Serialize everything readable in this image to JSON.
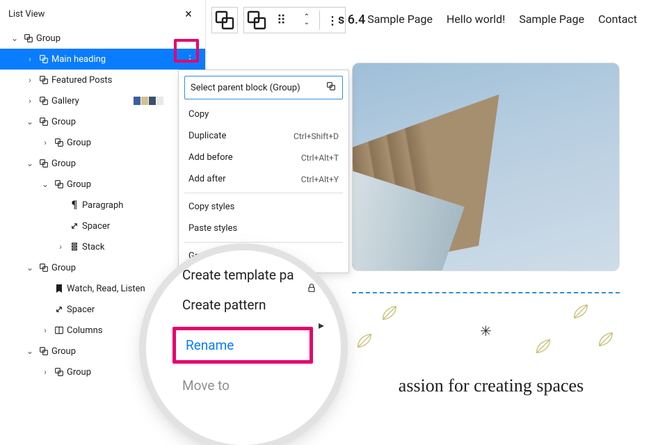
{
  "listView": {
    "title": "List View",
    "items": [
      {
        "toggle": "v",
        "icon": "group",
        "label": "Group",
        "indent": 0
      },
      {
        "toggle": ">",
        "icon": "group",
        "label": "Main heading",
        "indent": 1,
        "selected": true,
        "showActions": true
      },
      {
        "toggle": ">",
        "icon": "group",
        "label": "Featured Posts",
        "indent": 1
      },
      {
        "toggle": ">",
        "icon": "group",
        "label": "Gallery",
        "indent": 1,
        "thumbs": true
      },
      {
        "toggle": "v",
        "icon": "group",
        "label": "Group",
        "indent": 1
      },
      {
        "toggle": ">",
        "icon": "group",
        "label": "Group",
        "indent": 2
      },
      {
        "toggle": "v",
        "icon": "group",
        "label": "Group",
        "indent": 1
      },
      {
        "toggle": "v",
        "icon": "group",
        "label": "Group",
        "indent": 2
      },
      {
        "toggle": "",
        "icon": "paragraph",
        "label": "Paragraph",
        "indent": 3
      },
      {
        "toggle": "",
        "icon": "spacer",
        "label": "Spacer",
        "indent": 3
      },
      {
        "toggle": ">",
        "icon": "stack",
        "label": "Stack",
        "indent": 3
      },
      {
        "toggle": "v",
        "icon": "group",
        "label": "Group",
        "indent": 1
      },
      {
        "toggle": "",
        "icon": "bookmark",
        "label": "Watch, Read, Listen",
        "indent": 2
      },
      {
        "toggle": "",
        "icon": "spacer",
        "label": "Spacer",
        "indent": 2
      },
      {
        "toggle": ">",
        "icon": "columns",
        "label": "Columns",
        "indent": 2
      },
      {
        "toggle": "v",
        "icon": "group",
        "label": "Group",
        "indent": 1
      },
      {
        "toggle": ">",
        "icon": "group",
        "label": "Group",
        "indent": 2
      }
    ]
  },
  "siteTitleFragment": "s 6.4",
  "topNav": [
    "Sample Page",
    "Hello world!",
    "Sample Page",
    "Contact"
  ],
  "ctx": {
    "parent": "Select parent block (Group)",
    "items": [
      {
        "label": "Copy"
      },
      {
        "label": "Duplicate",
        "shortcut": "Ctrl+Shift+D"
      },
      {
        "label": "Add before",
        "shortcut": "Ctrl+Alt+T"
      },
      {
        "label": "Add after",
        "shortcut": "Ctrl+Alt+Y"
      },
      {
        "divider": true
      },
      {
        "label": "Copy styles"
      },
      {
        "label": "Paste styles"
      },
      {
        "divider": true
      },
      {
        "label": "Group"
      }
    ]
  },
  "magnifier": {
    "createTemplate": "Create template pa",
    "createPattern": "Create pattern",
    "rename": "Rename",
    "moveTo": "Move to"
  },
  "tagline": "assion for creating spaces"
}
